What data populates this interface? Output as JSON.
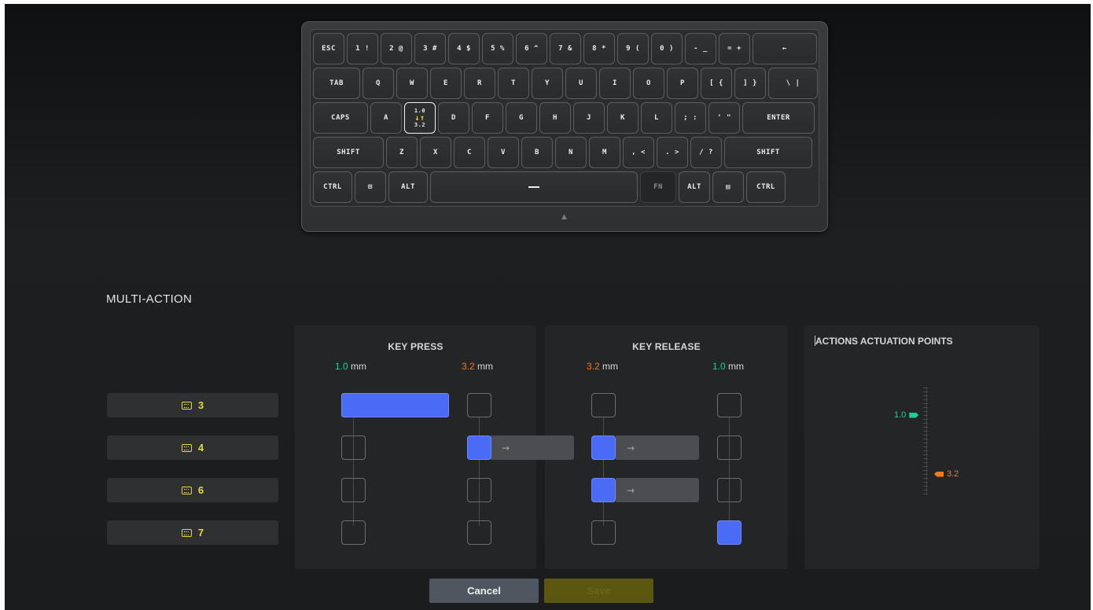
{
  "keyboard": {
    "rows": [
      [
        "ESC",
        "1 !",
        "2 @",
        "3 #",
        "4 $",
        "5 %",
        "6 ^",
        "7 &",
        "8 *",
        "9 (",
        "0 )",
        "- _",
        "= +",
        "←"
      ],
      [
        "TAB",
        "Q",
        "W",
        "E",
        "R",
        "T",
        "Y",
        "U",
        "I",
        "O",
        "P",
        "[ {",
        "] }",
        "\\ |"
      ],
      [
        "CAPS",
        "A",
        "",
        "D",
        "F",
        "G",
        "H",
        "J",
        "K",
        "L",
        "; :",
        "' \"",
        "ENTER"
      ],
      [
        "SHIFT",
        "Z",
        "X",
        "C",
        "V",
        "B",
        "N",
        "M",
        ", <",
        ". >",
        "/ ?",
        "SHIFT"
      ],
      [
        "CTRL",
        "⊞",
        "ALT",
        "",
        "FN",
        "ALT",
        "▤",
        "CTRL"
      ]
    ],
    "selected_key": {
      "top": "1.0",
      "bottom": "3.2",
      "arrows": "↓↑"
    }
  },
  "section_title": "MULTI-ACTION",
  "actions": [
    {
      "label": "3"
    },
    {
      "label": "4"
    },
    {
      "label": "6"
    },
    {
      "label": "7"
    }
  ],
  "key_press": {
    "title": "KEY PRESS",
    "col1": {
      "value": "1.0",
      "unit": " mm"
    },
    "col2": {
      "value": "3.2",
      "unit": " mm"
    }
  },
  "key_release": {
    "title": "KEY RELEASE",
    "col1": {
      "value": "3.2",
      "unit": " mm"
    },
    "col2": {
      "value": "1.0",
      "unit": " mm"
    }
  },
  "actuation": {
    "title": "ACTIONS ACTUATION POINTS",
    "press_point": "1.0",
    "release_point": "3.2"
  },
  "arrow_glyph": "→",
  "buttons": {
    "cancel": "Cancel",
    "save": "Save"
  },
  "colors": {
    "active": "#4a6bf5",
    "press_green": "#1ccf93",
    "release_orange": "#f07a1d",
    "action_yellow": "#e4d93f"
  }
}
